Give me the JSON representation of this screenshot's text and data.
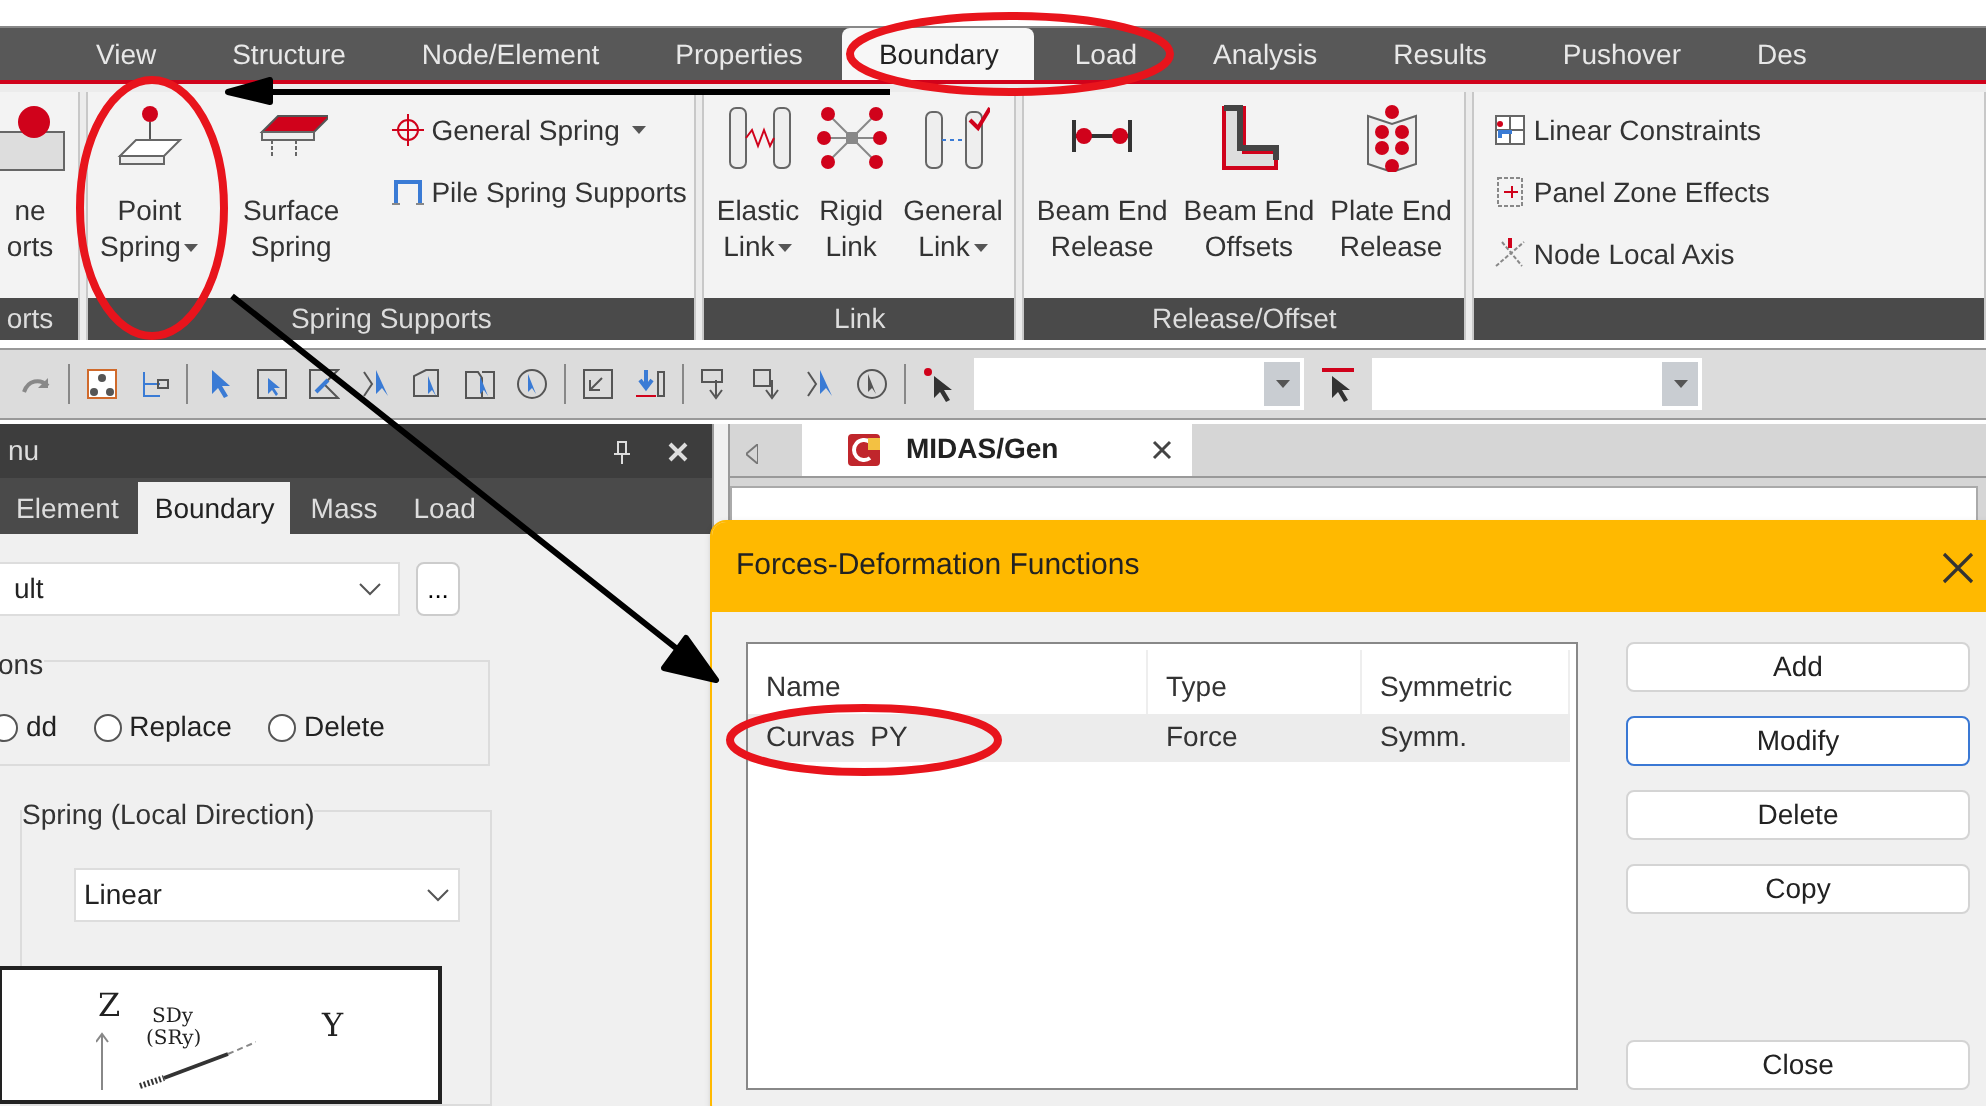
{
  "menu_tabs": [
    {
      "label": "View",
      "selected": false
    },
    {
      "label": "Structure",
      "selected": false
    },
    {
      "label": "Node/Element",
      "selected": false
    },
    {
      "label": "Properties",
      "selected": false
    },
    {
      "label": "Boundary",
      "selected": true
    },
    {
      "label": "Load",
      "selected": false
    },
    {
      "label": "Analysis",
      "selected": false
    },
    {
      "label": "Results",
      "selected": false
    },
    {
      "label": "Pushover",
      "selected": false
    },
    {
      "label": "Des",
      "selected": false
    }
  ],
  "ribbon": {
    "groups": [
      {
        "label": "orts",
        "items": [
          {
            "kind": "large",
            "lines": [
              "ne",
              "orts"
            ],
            "dropdown": false
          }
        ]
      },
      {
        "label": "Spring Supports",
        "items": [
          {
            "kind": "large",
            "lines": [
              "Point",
              "Spring"
            ],
            "dropdown": true
          },
          {
            "kind": "large",
            "lines": [
              "Surface",
              "Spring"
            ],
            "dropdown": false
          },
          {
            "kind": "small",
            "label": "General Spring",
            "dropdown": true
          },
          {
            "kind": "small",
            "label": "Pile Spring Supports",
            "dropdown": false
          }
        ]
      },
      {
        "label": "Link",
        "items": [
          {
            "kind": "large",
            "lines": [
              "Elastic",
              "Link"
            ],
            "dropdown": true
          },
          {
            "kind": "large",
            "lines": [
              "Rigid",
              "Link"
            ],
            "dropdown": false
          },
          {
            "kind": "large",
            "lines": [
              "General",
              "Link"
            ],
            "dropdown": true
          }
        ]
      },
      {
        "label": "Release/Offset",
        "items": [
          {
            "kind": "large",
            "lines": [
              "Beam End",
              "Release"
            ],
            "dropdown": false
          },
          {
            "kind": "large",
            "lines": [
              "Beam End",
              "Offsets"
            ],
            "dropdown": false
          },
          {
            "kind": "large",
            "lines": [
              "Plate End",
              "Release"
            ],
            "dropdown": false
          }
        ]
      },
      {
        "items": [
          {
            "kind": "small",
            "label": "Linear Constraints",
            "dropdown": false
          },
          {
            "kind": "small",
            "label": "Panel Zone Effects",
            "dropdown": false
          },
          {
            "kind": "small",
            "label": "Node Local Axis",
            "dropdown": false
          }
        ]
      }
    ]
  },
  "side_panel": {
    "title": "nu",
    "tabs": [
      {
        "label": "Element",
        "selected": false
      },
      {
        "label": "Boundary",
        "selected": true
      },
      {
        "label": "Mass",
        "selected": false
      },
      {
        "label": "Load",
        "selected": false
      }
    ],
    "group_select": {
      "value": "ult",
      "button": "..."
    },
    "options": {
      "title": "ons",
      "radios": [
        {
          "label": "dd",
          "selected": false
        },
        {
          "label": "Replace",
          "selected": false
        },
        {
          "label": "Delete",
          "selected": false
        }
      ]
    },
    "spring": {
      "title": "Spring (Local Direction)",
      "type": "Linear",
      "diagram_labels": [
        "Z",
        "SDy",
        "(SRy)",
        "Y"
      ]
    }
  },
  "document_tab": {
    "label": "MIDAS/Gen"
  },
  "dialog": {
    "title": "Forces-Deformation Functions",
    "columns": [
      "Name",
      "Type",
      "Symmetric"
    ],
    "rows": [
      {
        "cells": [
          "Curvas  PY",
          "Force",
          "Symm."
        ],
        "selected": true
      }
    ],
    "buttons": [
      {
        "label": "Add",
        "focused": false
      },
      {
        "label": "Modify",
        "focused": true
      },
      {
        "label": "Delete",
        "focused": false
      },
      {
        "label": "Copy",
        "focused": false
      }
    ],
    "close_button": {
      "label": "Close",
      "focused": false
    }
  }
}
